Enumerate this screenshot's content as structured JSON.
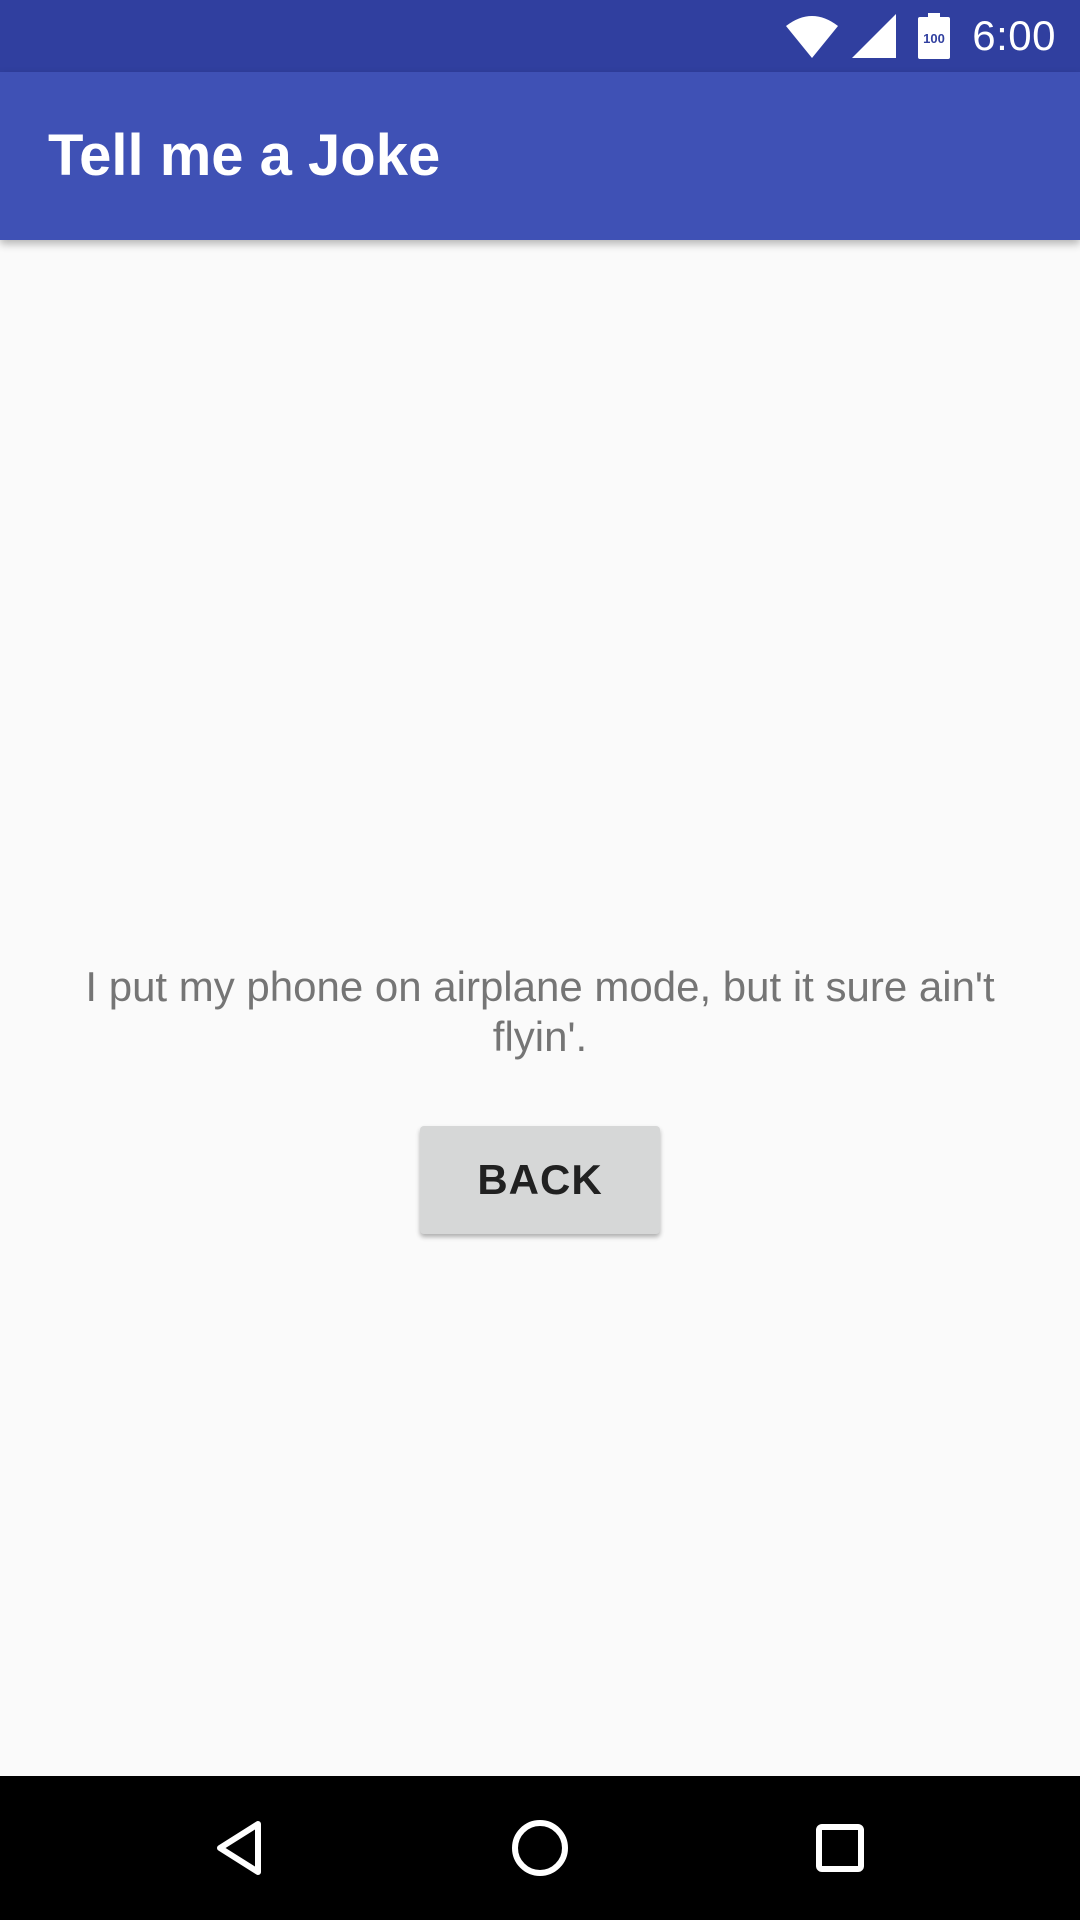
{
  "status_bar": {
    "time": "6:00",
    "battery_level": "100",
    "icons": [
      "wifi-icon",
      "cell-signal-icon",
      "battery-icon"
    ],
    "background_color": "#303f9f"
  },
  "app_bar": {
    "title": "Tell me a Joke",
    "background_color": "#3f51b5"
  },
  "main": {
    "joke_text": "I put my phone on airplane mode, but it sure ain't flyin'.",
    "back_button_label": "BACK"
  },
  "nav_bar": {
    "icons": [
      "back-triangle-icon",
      "home-circle-icon",
      "recents-square-icon"
    ]
  }
}
